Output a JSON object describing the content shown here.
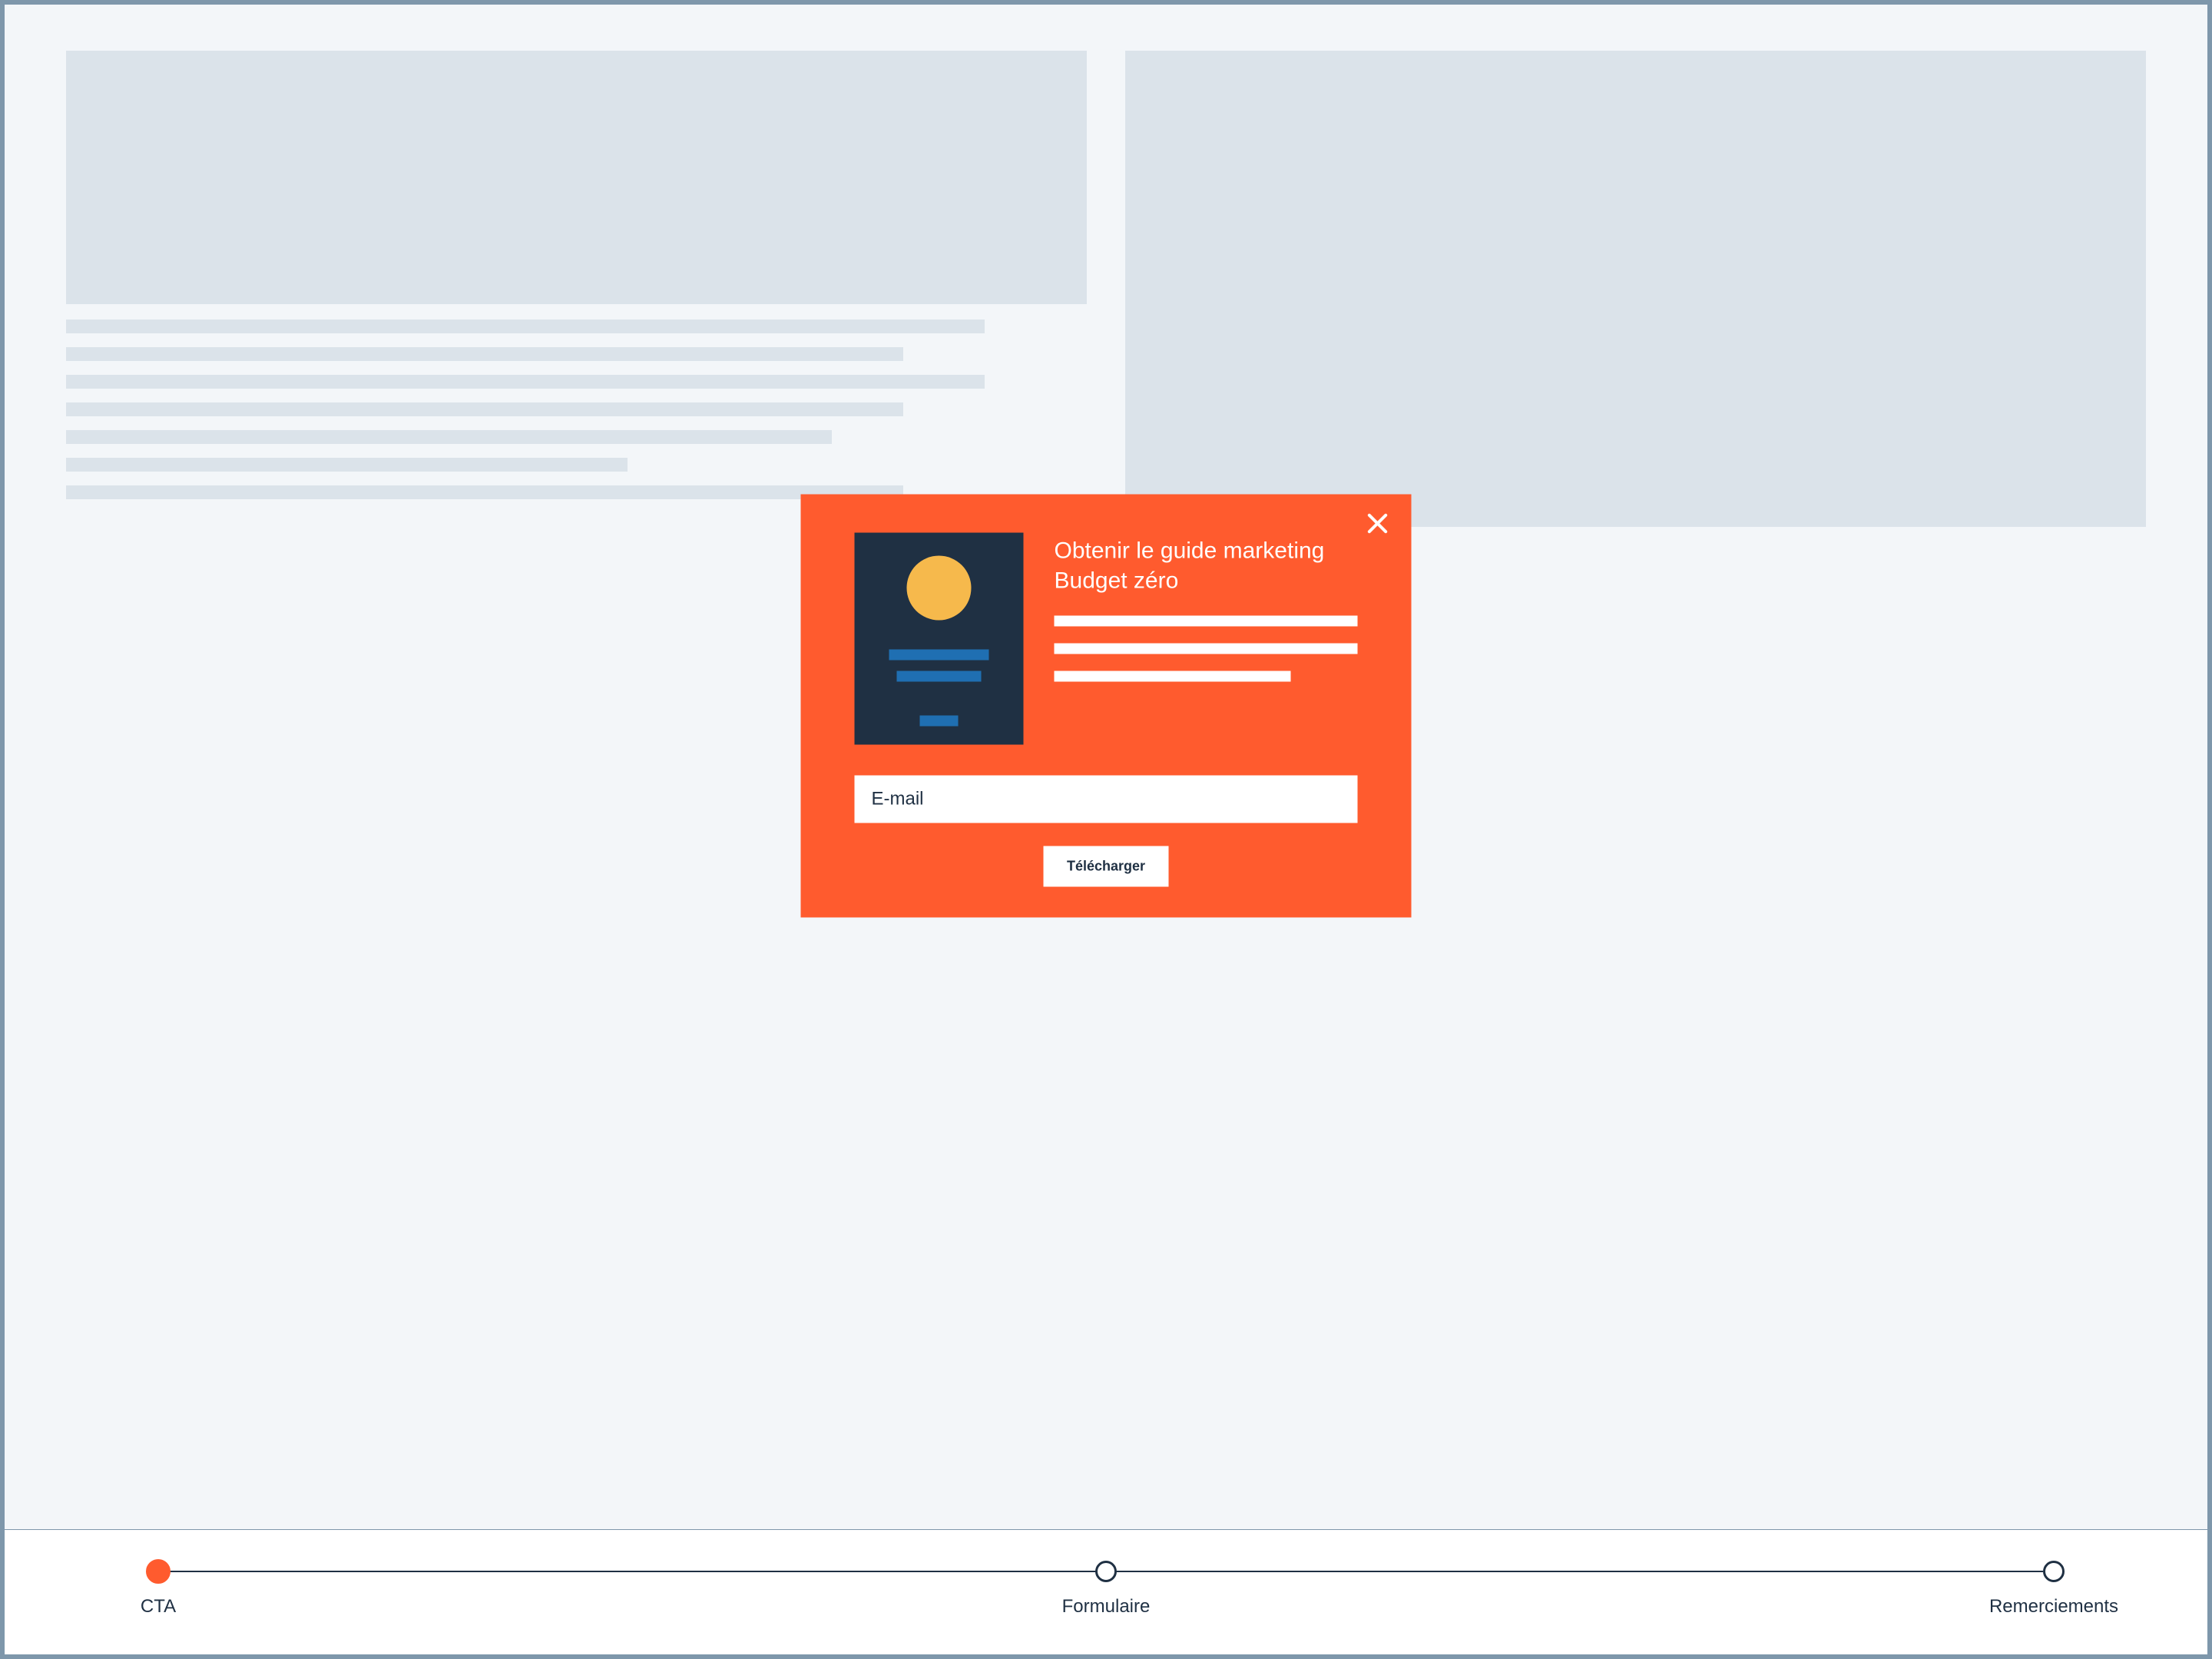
{
  "modal": {
    "title": "Obtenir le guide marketing Budget zéro",
    "email_placeholder": "E-mail",
    "download_label": "Télécharger",
    "close_icon": "close-icon"
  },
  "stepper": {
    "steps": [
      {
        "label": "CTA",
        "active": true
      },
      {
        "label": "Formulaire",
        "active": false
      },
      {
        "label": "Remerciements",
        "active": false
      }
    ]
  },
  "colors": {
    "accent": "#ff5b2e",
    "navy": "#1f3043",
    "sun": "#f6b94c",
    "blue": "#1f6fb2",
    "frame": "#7e97ab",
    "bg": "#f3f6f9",
    "ph": "#dbe3ea"
  }
}
